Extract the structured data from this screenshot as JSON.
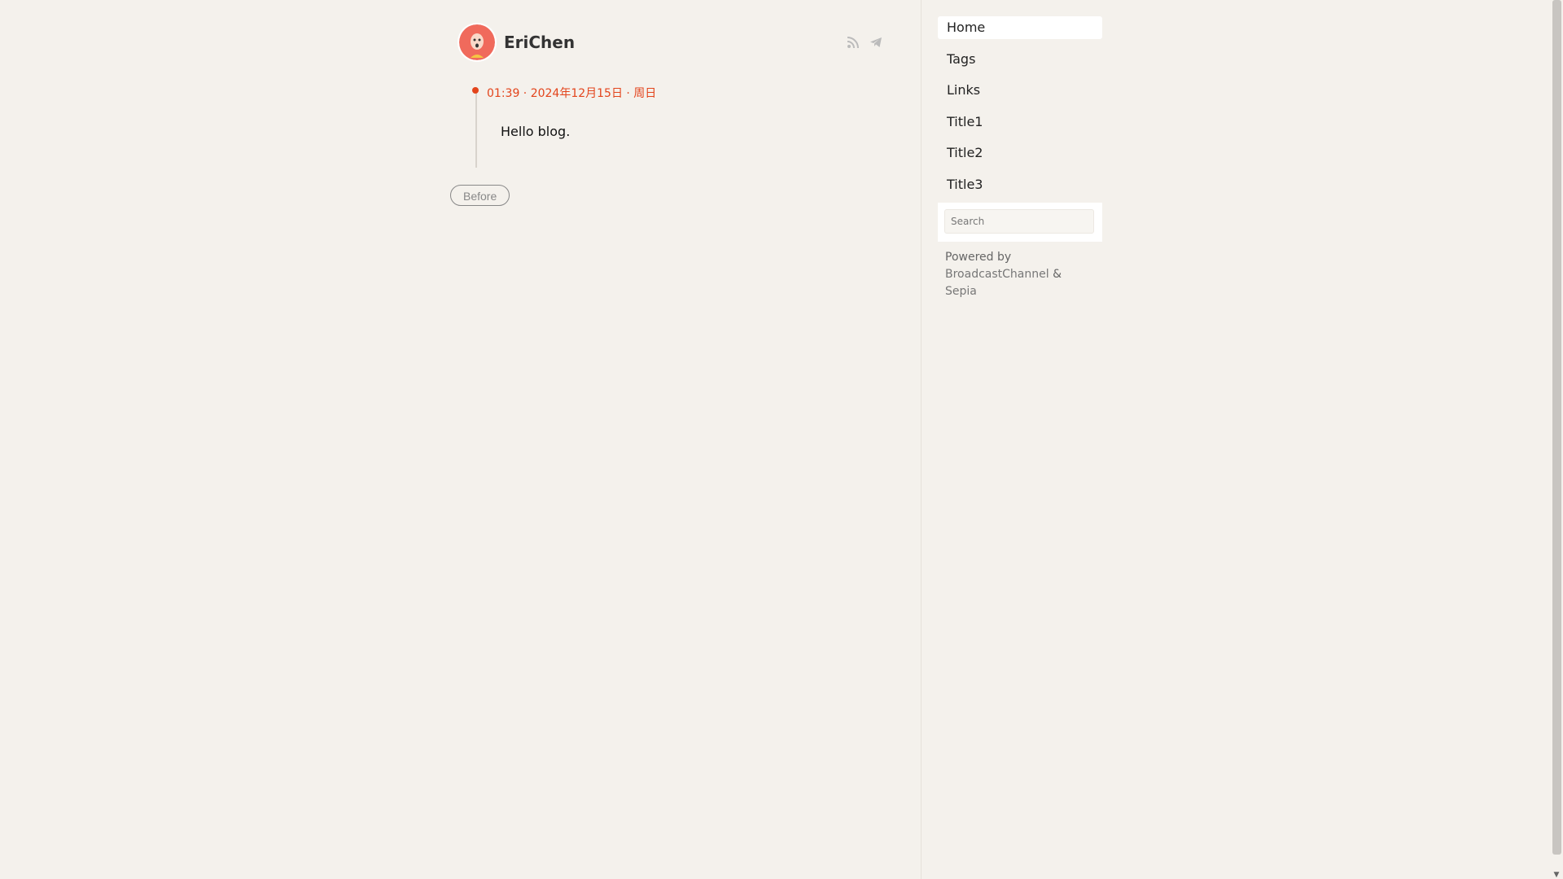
{
  "header": {
    "site_title": "EriChen",
    "icons": [
      "rss-icon",
      "telegram-icon"
    ]
  },
  "post": {
    "meta": "01:39 · 2024年12月15日 · 周日",
    "body": "Hello blog."
  },
  "pagination": {
    "before_label": "Before"
  },
  "sidebar": {
    "items": [
      {
        "label": "Home",
        "active": true
      },
      {
        "label": "Tags"
      },
      {
        "label": "Links"
      },
      {
        "label": "Title1"
      },
      {
        "label": "Title2"
      },
      {
        "label": "Title3"
      }
    ],
    "search_placeholder": "Search",
    "powered_prefix": "Powered by",
    "powered_link1": "BroadcastChannel",
    "powered_amp": "&",
    "powered_link2": "Sepia"
  },
  "colors": {
    "accent": "#e3441b",
    "background": "#f4f1ec"
  }
}
